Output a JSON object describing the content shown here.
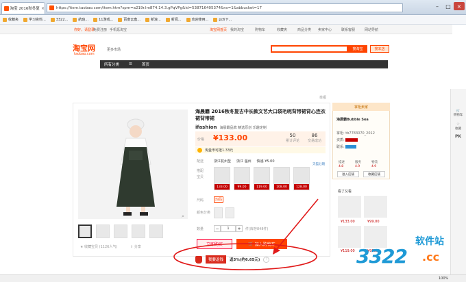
{
  "browser": {
    "tab_title": "淘宝 2016秋冬复古中长...",
    "url": "https://item.taobao.com/item.htm?spm=a219r.lm874.14.3.gPqVPg&id=538716405374&ns=1&abbucket=17",
    "bookmarks": [
      "收藏夹",
      "学习资料...",
      "3322...",
      "航班...",
      "11游戏...",
      "百度云盘...",
      "新浪...",
      "新闻...",
      "欢迎使用...",
      "pc6下..."
    ]
  },
  "topbar": {
    "left": [
      "你好，请登录",
      "免费注册",
      "手机逛淘宝"
    ],
    "right": [
      "淘宝网首页",
      "我的淘宝",
      "购物车",
      "收藏夹",
      "商品分类",
      "卖家中心",
      "联系客服",
      "网站导航"
    ]
  },
  "header": {
    "logo": "淘宝网",
    "logo_sub": "taobao.com",
    "more_market": "更多市场",
    "search_button": "搜淘宝",
    "store_button": "搜本店"
  },
  "nav": [
    "所有分类",
    "首页"
  ],
  "product": {
    "report": "举报",
    "title": "海晨霸 2016秋冬复古中长款文艺大口袋毛呢背带裙背心连衣裙背带裙",
    "brand_logo": "ifashion",
    "brand_text": "海晨霸品牌 精选原创 乐趣定制",
    "price_label": "价格",
    "price": "¥133.00",
    "stats": [
      {
        "value": "50",
        "label": "累计评论"
      },
      {
        "value": "86",
        "label": "交易成功"
      }
    ],
    "coupon": "淘金币可抵1.33元",
    "shipping_label": "配送",
    "shipping": [
      "浙江杭州至",
      "浙江 温州",
      "快递 ¥5.00"
    ],
    "installment": "天猫分期",
    "options_label": "搭配宝贝",
    "swatch_prices": [
      "133.00",
      "99.00",
      "119.00",
      "108.00",
      "128.00"
    ],
    "size_label": "尺码",
    "size": "均码",
    "color_label": "颜色分类",
    "qty_label": "数量",
    "qty": "1",
    "stock": "件(库存848件)",
    "buy_now": "立即购买",
    "add_cart": "加入购物车",
    "collect": "收藏宝贝 (1126人气)",
    "share": "分享",
    "rebate_button": "我要返钱",
    "rebate_text": "返5%(约6.65元)"
  },
  "shop": {
    "header": "掌柜卖家",
    "name": "海晨霸Bubble Sea",
    "owner": "掌柜: tb7783070_2012",
    "qualification": "资质:",
    "contact": "联系:",
    "scores": [
      {
        "label": "描述",
        "value": "4.8"
      },
      {
        "label": "服务",
        "value": "4.9"
      },
      {
        "label": "物流",
        "value": "4.9"
      }
    ],
    "enter_shop": "进入店铺",
    "collect_shop": "收藏店铺",
    "seen_title": "看了又看",
    "seen_prices": [
      "¥133.00",
      "¥99.00",
      "¥119.00",
      "¥98.00"
    ]
  },
  "rail": [
    "购物车",
    "收藏",
    "PK"
  ],
  "watermark": {
    "num": "3322",
    "soft": "软件站",
    "cc": ".cc"
  },
  "status": {
    "zoom": "100%"
  },
  "colors": {
    "accent": "#ff4400",
    "annotation_red": "#e11a1a",
    "watermark_blue": "#1f9ad6"
  }
}
